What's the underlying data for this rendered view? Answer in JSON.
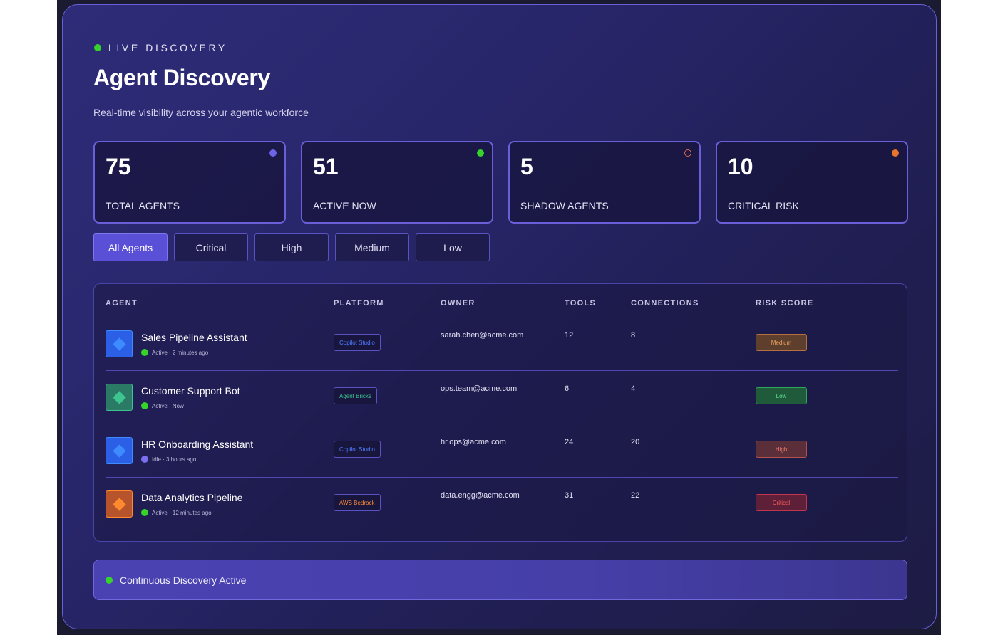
{
  "header": {
    "live_label": "LIVE DISCOVERY",
    "title": "Agent Discovery",
    "subtitle": "Real-time visibility across your agentic workforce"
  },
  "stats": [
    {
      "value": "75",
      "label": "TOTAL AGENTS",
      "indicator_color": "#6d63e6",
      "indicator_style": "filled"
    },
    {
      "value": "51",
      "label": "ACTIVE NOW",
      "indicator_color": "#35d32c",
      "indicator_style": "filled"
    },
    {
      "value": "5",
      "label": "SHADOW AGENTS",
      "indicator_color": "#e06a4a",
      "indicator_style": "ring"
    },
    {
      "value": "10",
      "label": "CRITICAL RISK",
      "indicator_color": "#e8742e",
      "indicator_style": "filled"
    }
  ],
  "filters": [
    {
      "label": "All Agents",
      "active": true
    },
    {
      "label": "Critical",
      "active": false
    },
    {
      "label": "High",
      "active": false
    },
    {
      "label": "Medium",
      "active": false
    },
    {
      "label": "Low",
      "active": false
    }
  ],
  "table": {
    "headers": {
      "agent": "AGENT",
      "platform": "PLATFORM",
      "owner": "OWNER",
      "tools": "TOOLS",
      "connections": "CONNECTIONS",
      "risk": "RISK SCORE"
    },
    "rows": [
      {
        "name": "Sales Pipeline Assistant",
        "status": "Active · 2 minutes ago",
        "status_color": "#35d32c",
        "icon_bg": "#2a5fe6",
        "icon_color": "#3d8bff",
        "platform": "Copilot Studio",
        "platform_color": "#4f7cff",
        "owner": "sarah.chen@acme.com",
        "tools": "12",
        "connections": "8",
        "risk": "Medium",
        "risk_bg": "#5e3e2c",
        "risk_border": "#b6703f",
        "risk_text": "#f0a565"
      },
      {
        "name": "Customer Support Bot",
        "status": "Active · Now",
        "status_color": "#35d32c",
        "icon_bg": "#2a7a66",
        "icon_color": "#3ec48f",
        "platform": "Agent Bricks",
        "platform_color": "#3ec48f",
        "owner": "ops.team@acme.com",
        "tools": "6",
        "connections": "4",
        "risk": "Low",
        "risk_bg": "#1f5a3a",
        "risk_border": "#2fa85d",
        "risk_text": "#5de08e"
      },
      {
        "name": "HR Onboarding Assistant",
        "status": "Idle · 3 hours ago",
        "status_color": "#7b6ff0",
        "icon_bg": "#2a5fe6",
        "icon_color": "#3d8bff",
        "platform": "Copilot Studio",
        "platform_color": "#4f7cff",
        "owner": "hr.ops@acme.com",
        "tools": "24",
        "connections": "20",
        "risk": "High",
        "risk_bg": "#5a2f3a",
        "risk_border": "#b2504e",
        "risk_text": "#f07a6c"
      },
      {
        "name": "Data Analytics Pipeline",
        "status": "Active · 12 minutes ago",
        "status_color": "#35d32c",
        "icon_bg": "#b8542c",
        "icon_color": "#ff8a2e",
        "platform": "AWS Bedrock",
        "platform_color": "#ff8a3a",
        "owner": "data.engg@acme.com",
        "tools": "31",
        "connections": "22",
        "risk": "Critical",
        "risk_bg": "#5e2038",
        "risk_border": "#c2354c",
        "risk_text": "#ff5a5a"
      }
    ]
  },
  "footer": {
    "status_text": "Continuous Discovery Active"
  }
}
